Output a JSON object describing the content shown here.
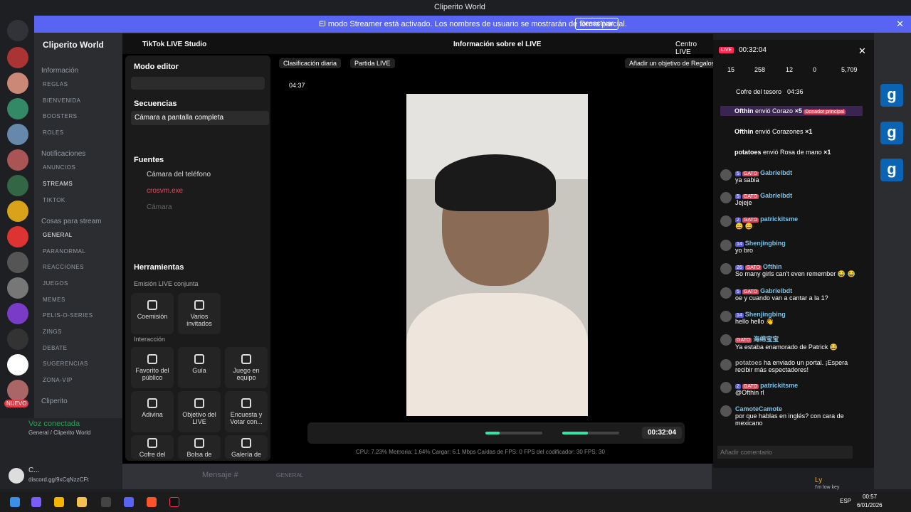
{
  "window": {
    "title": "Cliperito World"
  },
  "banner": {
    "message": "El modo Streamer está activado. Los nombres de usuario se mostrarán de forma parcial.",
    "button": "Desactivar"
  },
  "discord": {
    "server_name": "Cliperito World",
    "categories": [
      {
        "label": "Información",
        "channels": [
          "REGLAS",
          "BIENVENIDA",
          "BOOSTERS",
          "ROLES"
        ]
      },
      {
        "label": "Notificaciones",
        "channels": [
          "ANUNCIOS",
          "STREAMS",
          "TIKTOK"
        ]
      },
      {
        "label": "Cosas para stream",
        "channels": [
          "GENERAL",
          "PARANORMAL",
          "REACCIONES",
          "JUEGOS",
          "MEMES",
          "PELIS-O-SERIES",
          "ZINGS",
          "DEBATE",
          "SUGERENCIAS",
          "ZONA-VIP"
        ]
      },
      {
        "label": "Cliperito",
        "channels": []
      }
    ],
    "new_badge": "NUEVO",
    "voice_status": "Voz conectada",
    "voice_channel": "General / Cliperito World",
    "user_name": "C...",
    "user_status": "discord.gg/9xCqNzzCFt",
    "message_placeholder": "Mensaje #",
    "message_channel": "GENERAL",
    "right_member": "Ly",
    "right_member_status": "I'm low key"
  },
  "studio": {
    "app_title": "TikTok LIVE Studio",
    "center_title": "Información sobre el LIVE",
    "centro": "Centro LIVE",
    "mode": "Modo editor",
    "secuencias": "Secuencias",
    "escena": "Cámara a pantalla completa",
    "fuentes": "Fuentes",
    "sources": [
      "Cámara del teléfono",
      "crosvm.exe",
      "Cámara"
    ],
    "herramientas": "Herramientas",
    "emision": "Emisión LIVE conjunta",
    "tools1": [
      "Coemisión",
      "Varios invitados"
    ],
    "interaccion": "Interacción",
    "tools2": [
      "Favorito del público",
      "Guía",
      "Juego en equipo",
      "Adivina",
      "Objetivo del LIVE",
      "Encuesta y Votar con...",
      "Cofre del",
      "Bolsa de",
      "Galería de"
    ],
    "chips": [
      "Clasificación diaria",
      "Partida LIVE"
    ],
    "goal": "Añadir un objetivo de Regalos",
    "timer_small": "04:37",
    "timer": "00:32:04",
    "stats": "CPU: 7.23%   Memoria: 1.64%   Cargar: 6.1 Mbps   Caídas de FPS: 0   FPS del codificador: 30   FPS: 30"
  },
  "live": {
    "badge": "LIVE",
    "time": "00:32:04",
    "counts": {
      "viewers": "15",
      "views": "258",
      "gifts": "12",
      "shares": "0",
      "likes": "5,709"
    },
    "treasure": "Cofre del tesoro",
    "treasure_time": "04:36",
    "gifts": [
      {
        "user": "Ofthin",
        "text": "envió Corazo",
        "qty": "×5",
        "tag": "Donador principal"
      },
      {
        "user": "Ofthin",
        "text": "envió Corazones",
        "qty": "×1"
      },
      {
        "user": "potatoes",
        "text": "envió Rosa de mano",
        "qty": "×1"
      }
    ],
    "messages": [
      {
        "lvl": "5",
        "badge": "GATO",
        "user": "Gabrielbdt",
        "text": "ya sabia"
      },
      {
        "lvl": "5",
        "badge": "GATO",
        "user": "Gabrielbdt",
        "text": "Jejeje"
      },
      {
        "lvl": "2",
        "badge": "GATO",
        "user": "patrickitsme",
        "text": "😄 😄"
      },
      {
        "lvl": "14",
        "badge": "",
        "user": "Shenjingbing",
        "text": "yo bro"
      },
      {
        "lvl": "26",
        "badge": "GATO",
        "user": "Ofthin",
        "text": "So many girls can't even remember 😂 😂"
      },
      {
        "lvl": "5",
        "badge": "GATO",
        "user": "Gabrielbdt",
        "text": "oe y cuando van a cantar a la 1?"
      },
      {
        "lvl": "14",
        "badge": "",
        "user": "Shenjingbing",
        "text": "hello hello 👋"
      },
      {
        "lvl": "",
        "badge": "GATO",
        "user": "海绵宝宝",
        "text": "Ya estaba enamorado de Patrick 😂"
      },
      {
        "lvl": "",
        "badge": "",
        "user": "potatoes",
        "text": "ha enviado un portal. ¡Espera recibir más espectadores!"
      },
      {
        "lvl": "2",
        "badge": "GATO",
        "user": "patrickitsme",
        "text": "@Ofthin rl"
      },
      {
        "lvl": "",
        "badge": "",
        "user": "CamoteCamote",
        "text": "por que hablas en inglés? con cara de mexicano"
      }
    ],
    "comment_placeholder": "Añadir comentario"
  },
  "taskbar": {
    "time": "00:57",
    "date": "6/01/2026",
    "lang": "ESP"
  }
}
